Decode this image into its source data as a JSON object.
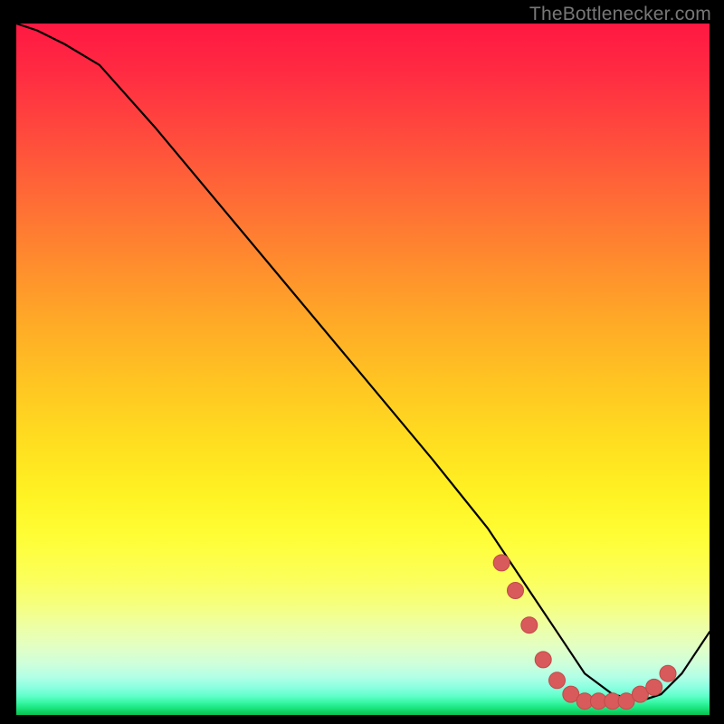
{
  "source_note": "TheBottlenecker.com",
  "colors": {
    "curve": "#000000",
    "dots": "#d85a5a",
    "dots_stroke": "#c14a4a"
  },
  "chart_data": {
    "type": "line",
    "title": "",
    "xlabel": "",
    "ylabel": "",
    "xlim": [
      0,
      100
    ],
    "ylim": [
      0,
      100
    ],
    "grid": false,
    "legend": false,
    "series": [
      {
        "name": "curve",
        "x": [
          0,
          3,
          7,
          12,
          20,
          30,
          40,
          50,
          60,
          68,
          74,
          78,
          82,
          86,
          90,
          93,
          96,
          100
        ],
        "y": [
          100,
          99,
          97,
          94,
          85,
          73,
          61,
          49,
          37,
          27,
          18,
          12,
          6,
          3,
          2,
          3,
          6,
          12
        ]
      }
    ],
    "points_overlay": {
      "name": "dots",
      "x": [
        70,
        72,
        74,
        76,
        78,
        80,
        82,
        84,
        86,
        88,
        90,
        92,
        94
      ],
      "y": [
        22,
        18,
        13,
        8,
        5,
        3,
        2,
        2,
        2,
        2,
        3,
        4,
        6
      ]
    }
  }
}
